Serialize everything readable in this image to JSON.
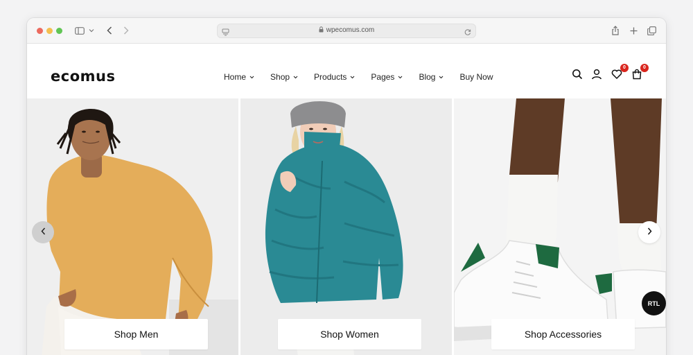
{
  "browser": {
    "url": "wpecomus.com"
  },
  "site": {
    "logo": "ecomus",
    "nav": [
      {
        "label": "Home",
        "has_dropdown": true
      },
      {
        "label": "Shop",
        "has_dropdown": true
      },
      {
        "label": "Products",
        "has_dropdown": true
      },
      {
        "label": "Pages",
        "has_dropdown": true
      },
      {
        "label": "Blog",
        "has_dropdown": true
      },
      {
        "label": "Buy Now",
        "has_dropdown": false
      }
    ],
    "header_icons": [
      {
        "name": "search-icon"
      },
      {
        "name": "account-icon"
      },
      {
        "name": "wishlist-icon",
        "badge": "0"
      },
      {
        "name": "cart-icon",
        "badge": "0"
      }
    ],
    "badge_color": "#d9251d"
  },
  "hero": {
    "panels": [
      {
        "button": "Shop Men"
      },
      {
        "button": "Shop Women"
      },
      {
        "button": "Shop Accessories"
      }
    ],
    "rtl_label": "RTL"
  }
}
